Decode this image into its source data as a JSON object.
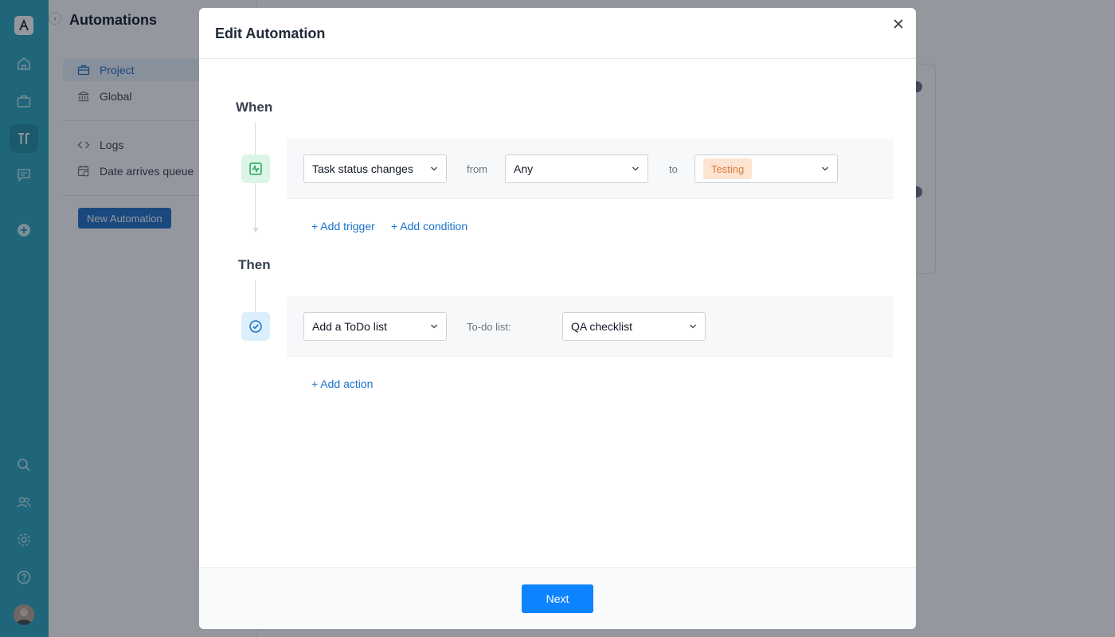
{
  "app": {
    "title": "Automations",
    "nav": [
      {
        "label": "Project",
        "icon": "briefcase-icon",
        "active": true
      },
      {
        "label": "Global",
        "icon": "bank-icon",
        "active": false
      }
    ],
    "nav_secondary": [
      {
        "label": "Logs",
        "icon": "code-icon"
      },
      {
        "label": "Date arrives queue",
        "icon": "calendar-clock-icon"
      }
    ],
    "new_automation_label": "New Automation",
    "rail_icons": [
      "app-logo-icon",
      "home-icon",
      "briefcase-icon",
      "automation-icon",
      "chat-icon",
      "add-circle-icon",
      "search-icon",
      "people-icon",
      "gear-icon",
      "help-icon",
      "avatar"
    ]
  },
  "modal": {
    "title": "Edit Automation",
    "when_label": "When",
    "then_label": "Then",
    "trigger": {
      "type": "Task status changes",
      "from_label": "from",
      "from_value": "Any",
      "to_label": "to",
      "to_value": "Testing"
    },
    "add_trigger": "+ Add trigger",
    "add_condition": "+ Add condition",
    "action": {
      "type": "Add a ToDo list",
      "list_label": "To-do list:",
      "list_value": "QA checklist"
    },
    "add_action": "+ Add action",
    "next_label": "Next"
  },
  "colors": {
    "rail": "#2aa6bf",
    "primary": "#0d84ff",
    "link": "#1a73c8",
    "tag_bg": "#fde3d2",
    "tag_text": "#d97a3b"
  }
}
